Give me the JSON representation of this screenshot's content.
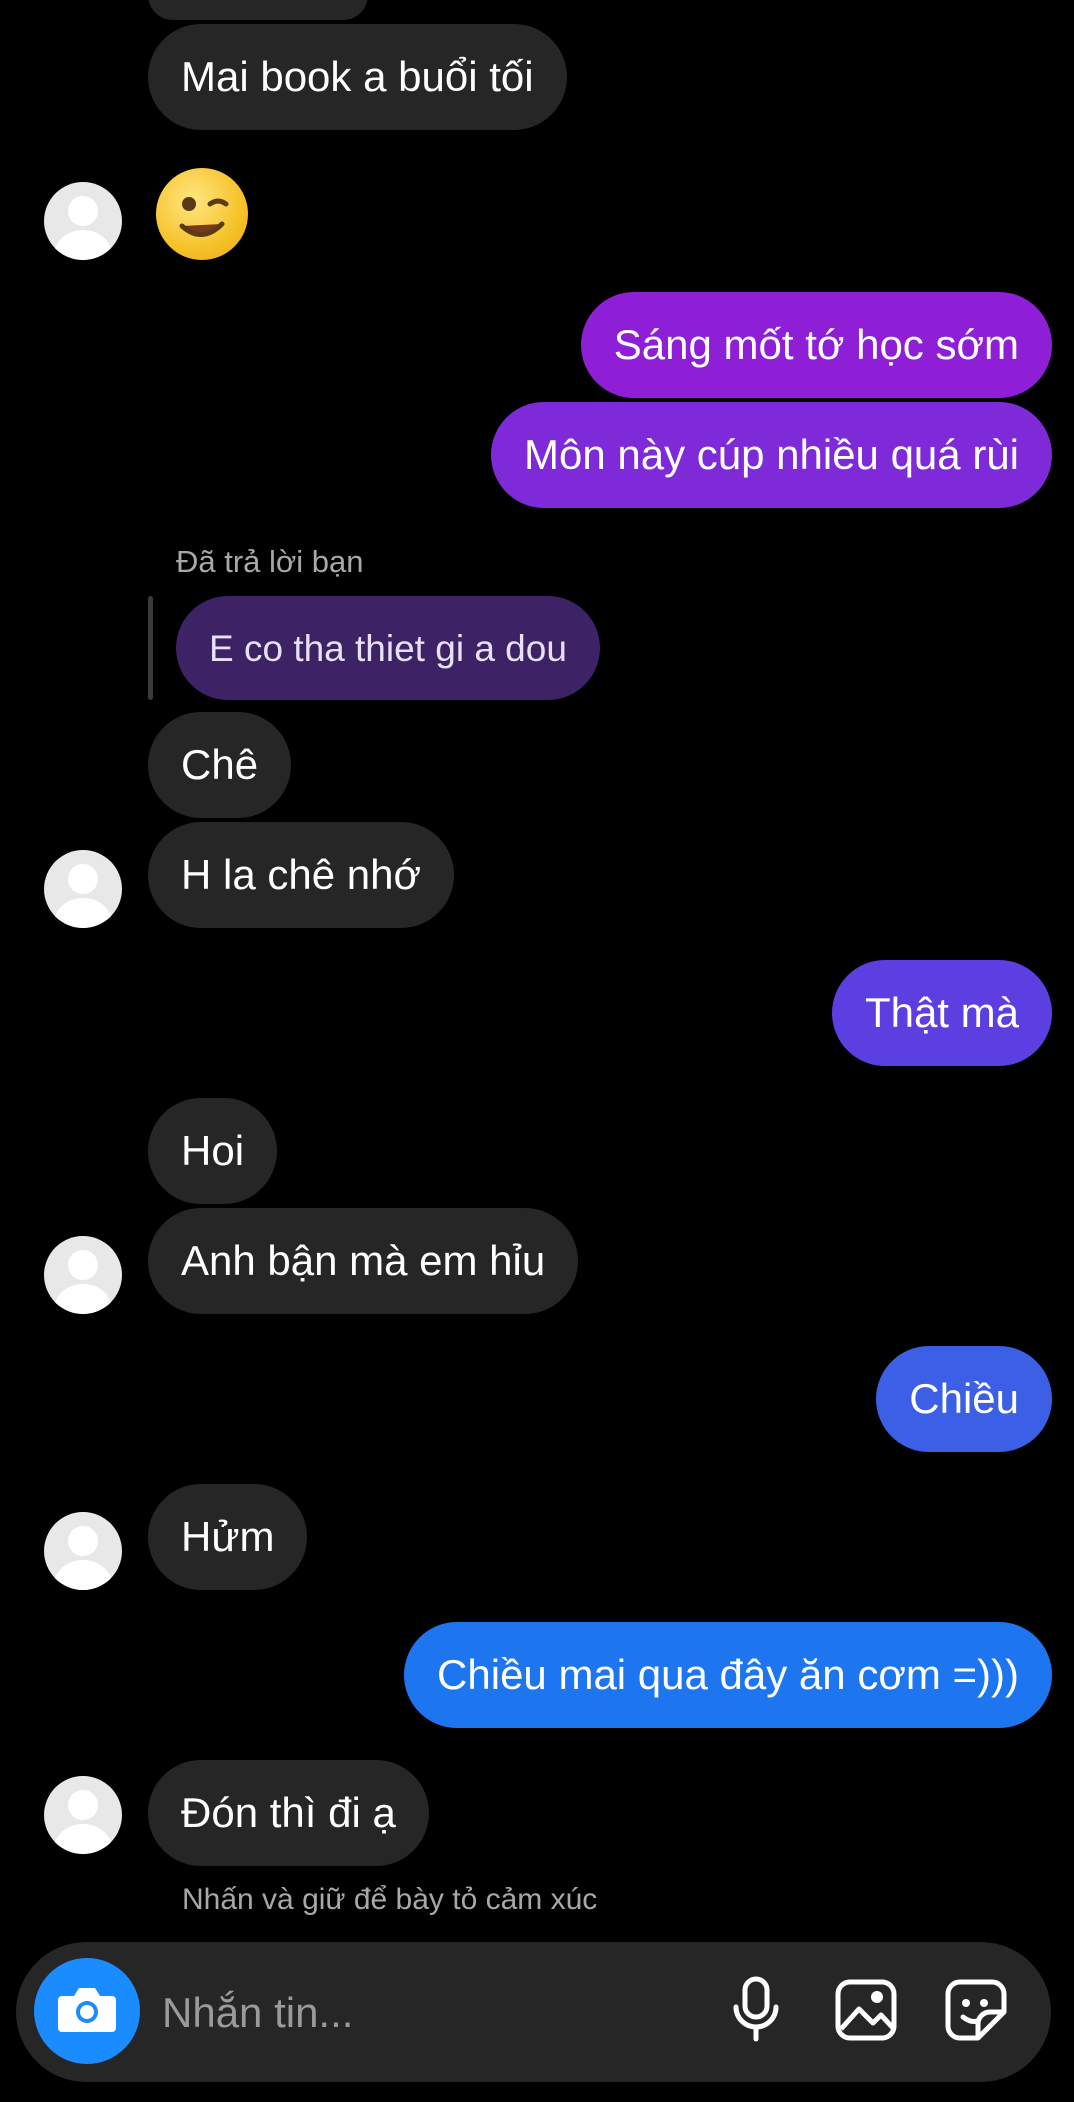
{
  "messages": [
    {
      "side": "in",
      "text": "Mai book a buổi tối"
    },
    {
      "side": "in",
      "type": "emoji",
      "emoji": "winking-face"
    },
    {
      "side": "out",
      "text": "Sáng mốt tớ học sớm",
      "color": "#8f1fd6"
    },
    {
      "side": "out",
      "text": "Môn này cúp nhiều quá rùi",
      "color": "#7f2ad8"
    },
    {
      "side": "in",
      "text": "Chê"
    },
    {
      "side": "in",
      "text": "H la chê nhớ"
    },
    {
      "side": "out",
      "text": "Thật mà",
      "color": "#5b3fe0"
    },
    {
      "side": "in",
      "text": "Hoi"
    },
    {
      "side": "in",
      "text": "Anh bận mà em hỉu"
    },
    {
      "side": "out",
      "text": "Chiều",
      "color": "#3b5fe5"
    },
    {
      "side": "in",
      "text": "Hửm"
    },
    {
      "side": "out",
      "text": "Chiều mai qua đây ăn cơm =)))",
      "color": "#1d76f0"
    },
    {
      "side": "in",
      "text": "Đón thì đi ạ"
    }
  ],
  "reply": {
    "label": "Đã trả lời bạn",
    "quoted_text": "E co tha thiet gi a dou",
    "quoted_color": "#3d2266"
  },
  "hint": "Nhấn và giữ để bày tỏ cảm xúc",
  "composer": {
    "placeholder": "Nhắn tin...",
    "icons": [
      "camera-icon",
      "microphone-icon",
      "image-icon",
      "sticker-icon"
    ],
    "camera_color": "#1a8cff"
  }
}
